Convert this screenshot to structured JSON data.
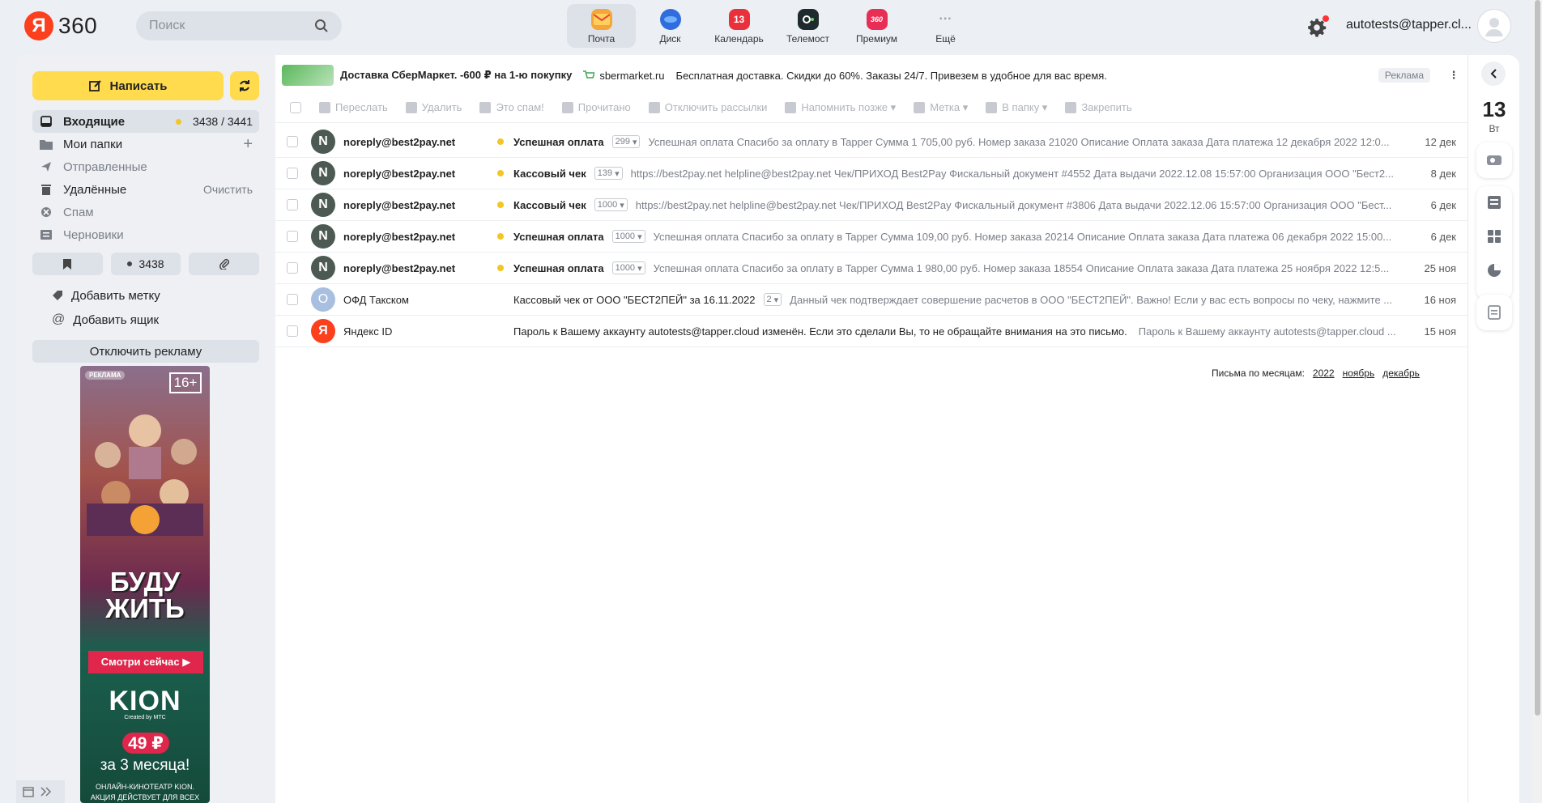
{
  "header": {
    "logo_letter": "Я",
    "logo_text": "360",
    "search_placeholder": "Поиск",
    "services": [
      {
        "label": "Почта",
        "icon": "mail-icon",
        "color": "#f7a23a",
        "active": true
      },
      {
        "label": "Диск",
        "icon": "disk-icon",
        "color": "#2f6dde"
      },
      {
        "label": "Календарь",
        "icon": "calendar-icon",
        "color": "#e8313b",
        "badge": "13"
      },
      {
        "label": "Телемост",
        "icon": "telemost-icon",
        "color": "#1f2a2e"
      },
      {
        "label": "Премиум",
        "icon": "premium-icon",
        "color": "#e82e54",
        "badge": "360"
      },
      {
        "label": "Ещё",
        "icon": "more-icon",
        "color": "#9aa0a8"
      }
    ],
    "user_email": "autotests@tapper.cl..."
  },
  "sidebar": {
    "compose_label": "Написать",
    "folders": [
      {
        "name": "Входящие",
        "icon": "inbox-icon",
        "unread_dot": true,
        "count": "3438 / 3441",
        "active": true
      },
      {
        "name": "Мои папки",
        "icon": "folder-icon",
        "action": "+"
      },
      {
        "name": "Отправленные",
        "icon": "send-icon",
        "muted": true
      },
      {
        "name": "Удалённые",
        "icon": "trash-icon",
        "action": "Очистить"
      },
      {
        "name": "Спам",
        "icon": "spam-icon",
        "muted": true
      },
      {
        "name": "Черновики",
        "icon": "draft-icon",
        "muted": true
      }
    ],
    "filters": {
      "unread_count": "3438"
    },
    "add_label": "Добавить метку",
    "add_mailbox": "Добавить ящик",
    "disable_ads": "Отключить рекламу",
    "ad": {
      "badge": "РЕКЛАМА",
      "age": "16+",
      "title_line1": "БУДУ",
      "title_line2": "ЖИТЬ",
      "button": "Смотри сейчас ▶",
      "brand": "KION",
      "brand_sub": "Created by МТС",
      "price": "49 ₽",
      "period": "за 3 месяца!",
      "foot_line1": "ОНЛАЙН-КИНОТЕАТР KION.",
      "foot_line2": "АКЦИЯ ДЕЙСТВУЕТ ДЛЯ ВСЕХ НОВЫХ"
    }
  },
  "top_ad": {
    "title": "Доставка СберМаркет. -600 ₽ на 1-ю покупку",
    "domain": "sbermarket.ru",
    "description": "Бесплатная доставка. Скидки до 60%. Заказы 24/7. Привезем в удобное для вас время.",
    "label": "Реклама"
  },
  "toolbar": [
    "Переслать",
    "Удалить",
    "Это спам!",
    "Прочитано",
    "Отключить рассылки",
    "Напомнить позже ▾",
    "Метка ▾",
    "В папку ▾",
    "Закрепить"
  ],
  "messages": [
    {
      "avatar": "N",
      "avatar_color": "#4d5a53",
      "sender": "noreply@best2pay.net",
      "unread": true,
      "subject": "Успешная оплата",
      "thread": "299",
      "snippet": "Успешная оплата Спасибо за оплату в Tapper Сумма 1 705,00 руб. Номер заказа 21020 Описание Оплата заказа Дата платежа 12 декабря 2022 12:0...",
      "date": "12 дек"
    },
    {
      "avatar": "N",
      "avatar_color": "#4d5a53",
      "sender": "noreply@best2pay.net",
      "unread": true,
      "subject": "Кассовый чек",
      "thread": "139",
      "snippet": "https://best2pay.net helpline@best2pay.net Чек/ПРИХОД Best2Pay Фискальный документ #4552 Дата выдачи 2022.12.08 15:57:00 Организация ООО \"Бест2...",
      "date": "8 дек"
    },
    {
      "avatar": "N",
      "avatar_color": "#4d5a53",
      "sender": "noreply@best2pay.net",
      "unread": true,
      "subject": "Кассовый чек",
      "thread": "1000",
      "snippet": "https://best2pay.net helpline@best2pay.net Чек/ПРИХОД Best2Pay Фискальный документ #3806 Дата выдачи 2022.12.06 15:57:00 Организация ООО \"Бест...",
      "date": "6 дек"
    },
    {
      "avatar": "N",
      "avatar_color": "#4d5a53",
      "sender": "noreply@best2pay.net",
      "unread": true,
      "subject": "Успешная оплата",
      "thread": "1000",
      "snippet": "Успешная оплата Спасибо за оплату в Tapper Сумма 109,00 руб. Номер заказа 20214 Описание Оплата заказа Дата платежа 06 декабря 2022 15:00...",
      "date": "6 дек"
    },
    {
      "avatar": "N",
      "avatar_color": "#4d5a53",
      "sender": "noreply@best2pay.net",
      "unread": true,
      "subject": "Успешная оплата",
      "thread": "1000",
      "snippet": "Успешная оплата Спасибо за оплату в Tapper Сумма 1 980,00 руб. Номер заказа 18554 Описание Оплата заказа Дата платежа 25 ноября 2022 12:5...",
      "date": "25 ноя"
    },
    {
      "avatar": "О",
      "avatar_color": "#a8bfe0",
      "sender": "ОФД Такском",
      "unread": false,
      "subject": "Кассовый чек от ООО \"БЕСТ2ПЕЙ\" за 16.11.2022",
      "thread": "2",
      "snippet": "Данный чек подтверждает совершение расчетов в ООО \"БЕСТ2ПЕЙ\". Важно! Если у вас есть вопросы по чеку, нажмите ...",
      "date": "16 ноя"
    },
    {
      "avatar": "Я",
      "avatar_color": "#fc3f1d",
      "sender": "Яндекс ID",
      "unread": false,
      "subject": "",
      "thread": "",
      "subject_plain": "Пароль к Вашему аккаунту autotests@tapper.cloud изменён. Если это сделали Вы, то не обращайте внимания на это письмо.",
      "snippet": "Пароль к Вашему аккаунту autotests@tapper.cloud ...",
      "date": "15 ноя"
    }
  ],
  "months": {
    "label": "Письма по месяцам:",
    "year": "2022",
    "items": [
      "ноябрь",
      "декабрь"
    ]
  },
  "rail": {
    "date": "13",
    "day": "Вт"
  }
}
